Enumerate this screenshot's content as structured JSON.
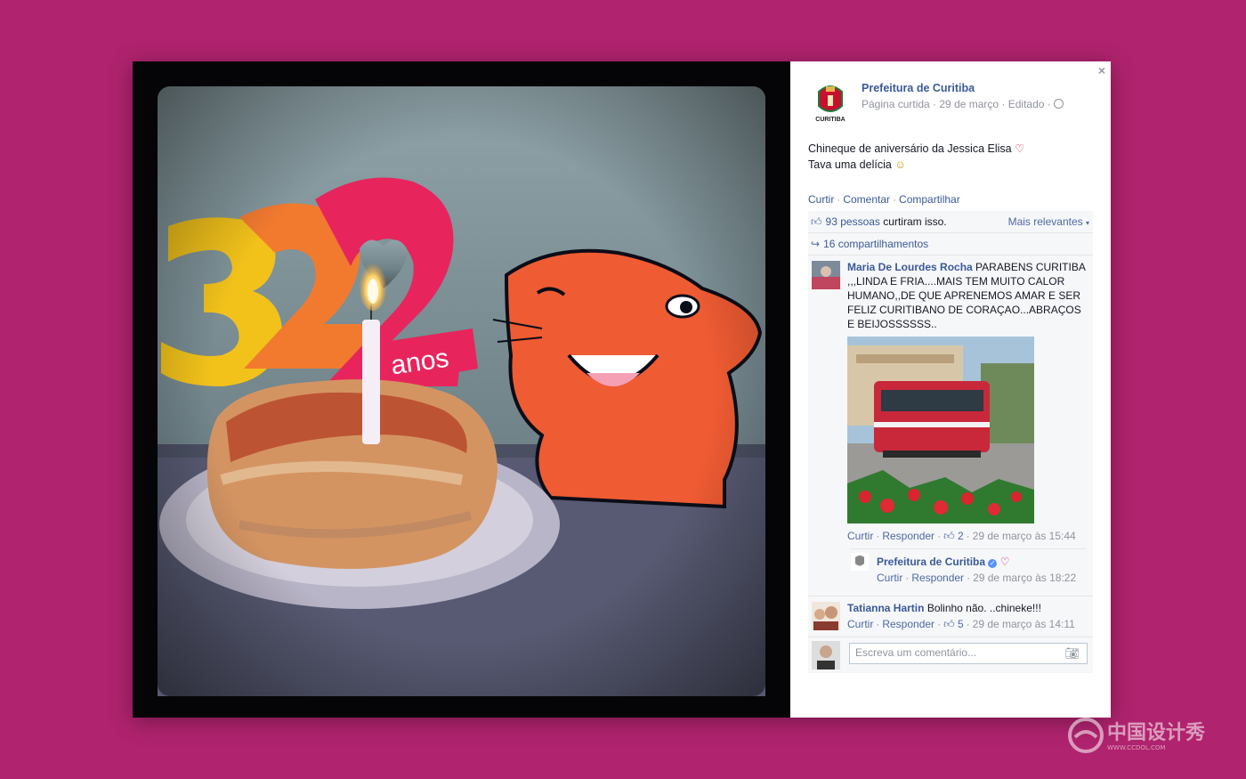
{
  "post": {
    "page_name": "Prefeitura de Curitiba",
    "logo_caption": "CURITIBA",
    "meta": "Página curtida · 29 de março · Editado ·",
    "text_line1": "Chineque de aniversário da Jessica Elisa",
    "text_line2": "Tava uma delícia",
    "heart_glyph": "♡",
    "smile_glyph": "☺",
    "actions": {
      "like": "Curtir",
      "comment": "Comentar",
      "share": "Compartilhar"
    }
  },
  "photo": {
    "number_label": "32",
    "anos_label": "anos",
    "icon": "birthday-pastry-photo"
  },
  "ufi": {
    "likes_count": "93 pessoas",
    "likes_suffix": "curtiram isso.",
    "sort_label": "Mais relevantes",
    "shares": "16 compartilhamentos"
  },
  "comments": [
    {
      "author": "Maria De Lourdes Rocha",
      "text": "PARABENS CURITIBA ,,,LINDA E FRIA....MAIS TEM MUITO CALOR HUMANO,,DE QUE APRENEMOS AMAR E SER FELIZ CURITIBANO DE CORAÇAO...ABRAÇOS E BEIJOSSSSSS..",
      "like": "Curtir",
      "reply": "Responder",
      "likes": "2",
      "time": "29 de março às 15:44",
      "reply_item": {
        "author": "Prefeitura de Curitiba",
        "heart": "♡",
        "like": "Curtir",
        "reply": "Responder",
        "time": "29 de março às 18:22"
      }
    },
    {
      "author": "Tatianna Hartin",
      "text": "Bolinho não. ..chineke!!!",
      "like": "Curtir",
      "reply": "Responder",
      "likes": "5",
      "time": "29 de março às 14:11"
    }
  ],
  "composer": {
    "placeholder": "Escreva um comentário..."
  },
  "close_glyph": "×",
  "watermark": {
    "text": "中国设计秀",
    "sub": "WWW.CCDOL.COM"
  },
  "colors": {
    "background": "#b0236e",
    "link": "#3b5998",
    "sidebar": "#ffffff"
  }
}
